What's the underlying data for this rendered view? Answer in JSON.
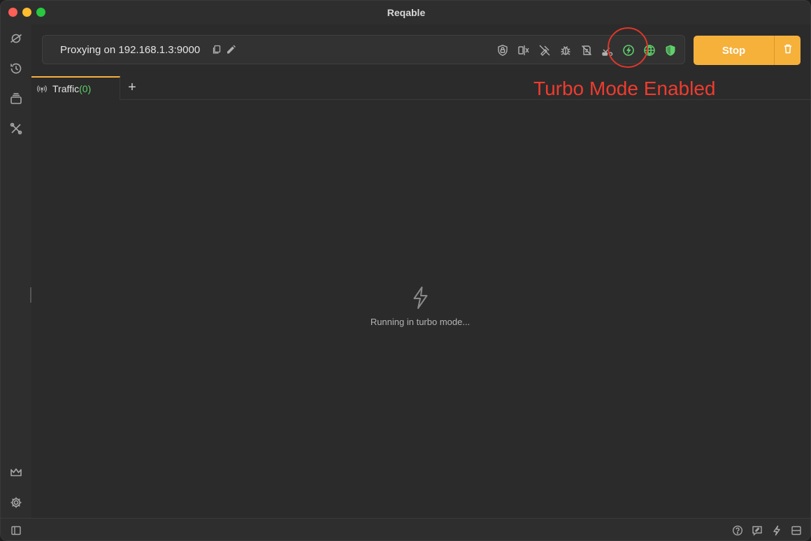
{
  "window": {
    "title": "Reqable"
  },
  "sidebar": {
    "items": [
      {
        "icon": "planet-icon"
      },
      {
        "icon": "history-icon"
      },
      {
        "icon": "stack-icon"
      },
      {
        "icon": "tools-icon"
      },
      {
        "icon": "crown-icon"
      },
      {
        "icon": "gear-icon"
      }
    ]
  },
  "proxy": {
    "status_text": "Proxying on 192.168.1.3:9000",
    "tools": [
      "ssl-lock-icon",
      "throttle-icon",
      "no-breakpoint-icon",
      "debug-icon",
      "rewrite-icon",
      "script-icon",
      "turbo-icon",
      "network-globe-icon",
      "shield-icon"
    ],
    "stop_label": "Stop"
  },
  "tabs": {
    "items": [
      {
        "label": "Traffic",
        "count": "(0)"
      }
    ],
    "add_label": "+"
  },
  "annotation": {
    "text": "Turbo Mode Enabled",
    "color": "#f03b2e"
  },
  "empty_state": {
    "message": "Running in turbo mode..."
  },
  "colors": {
    "accent": "#f6b13b",
    "success": "#5fd06a"
  }
}
